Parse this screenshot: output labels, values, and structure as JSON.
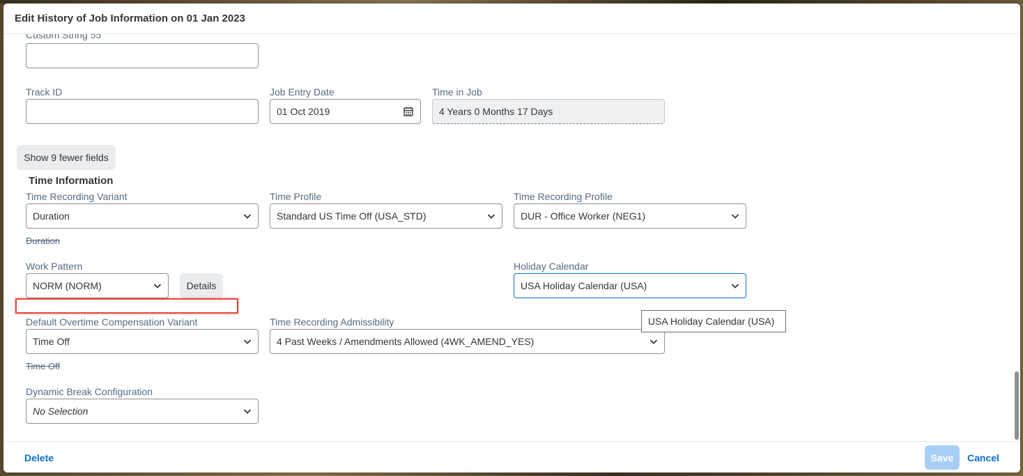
{
  "dialog": {
    "title": "Edit History of Job Information on 01 Jan 2023"
  },
  "fields": {
    "custom_string": {
      "label": "Custom String 55",
      "value": ""
    },
    "track_id": {
      "label": "Track ID",
      "value": ""
    },
    "job_entry_date": {
      "label": "Job Entry Date",
      "value": "01 Oct 2019"
    },
    "time_in_job": {
      "label": "Time in Job",
      "value": "4 Years 0 Months 17 Days"
    },
    "show_fewer_label": "Show 9 fewer fields"
  },
  "time_information": {
    "title": "Time Information",
    "time_recording_variant": {
      "label": "Time Recording Variant",
      "value": "Duration",
      "previous": "Duration"
    },
    "time_profile": {
      "label": "Time Profile",
      "value": "Standard US Time Off (USA_STD)"
    },
    "time_recording_profile": {
      "label": "Time Recording Profile",
      "value": "DUR - Office Worker (NEG1)"
    },
    "work_pattern": {
      "label": "Work Pattern",
      "value": "NORM (NORM)",
      "details_label": "Details"
    },
    "holiday_calendar": {
      "label": "Holiday Calendar",
      "value": "USA Holiday Calendar (USA)",
      "tooltip": "USA Holiday Calendar (USA)"
    },
    "default_overtime": {
      "label": "Default Overtime Compensation Variant",
      "value": "Time Off",
      "previous": "Time Off"
    },
    "time_recording_admissibility": {
      "label": "Time Recording Admissibility",
      "value": "4 Past Weeks / Amendments Allowed (4WK_AMEND_YES)"
    },
    "dynamic_break": {
      "label": "Dynamic Break Configuration",
      "value": "No Selection"
    }
  },
  "footer": {
    "delete_label": "Delete",
    "save_label": "Save",
    "cancel_label": "Cancel"
  },
  "icons": {
    "calendar": "calendar-icon",
    "dropdown": "chevron-down-icon"
  },
  "colors": {
    "accent": "#0a6ed1",
    "label": "#556b82",
    "highlight": "#e4463c",
    "save_disabled": "#a7cff5"
  }
}
